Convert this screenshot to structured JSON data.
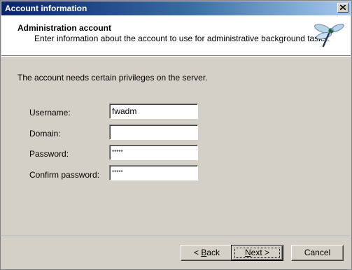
{
  "window": {
    "title": "Account information"
  },
  "header": {
    "title": "Administration account",
    "subtitle": "Enter information about the account to use for administrative background tasks.",
    "icon": "dragonfly-icon"
  },
  "main": {
    "intro": "The account needs certain privileges on the server.",
    "fields": [
      {
        "label": "Username:",
        "value": "fwadm"
      },
      {
        "label": "Domain:",
        "value": ""
      },
      {
        "label": "Password:",
        "value": "*****"
      },
      {
        "label": "Confirm password:",
        "value": "*****"
      }
    ]
  },
  "buttons": {
    "back_prefix": "< ",
    "back_mnemonic": "B",
    "back_rest": "ack",
    "next_mnemonic": "N",
    "next_rest": "ext >",
    "cancel": "Cancel"
  },
  "colors": {
    "dialog_bg": "#d4d0c8",
    "titlebar_start": "#0a246a",
    "titlebar_end": "#a6caf0"
  }
}
